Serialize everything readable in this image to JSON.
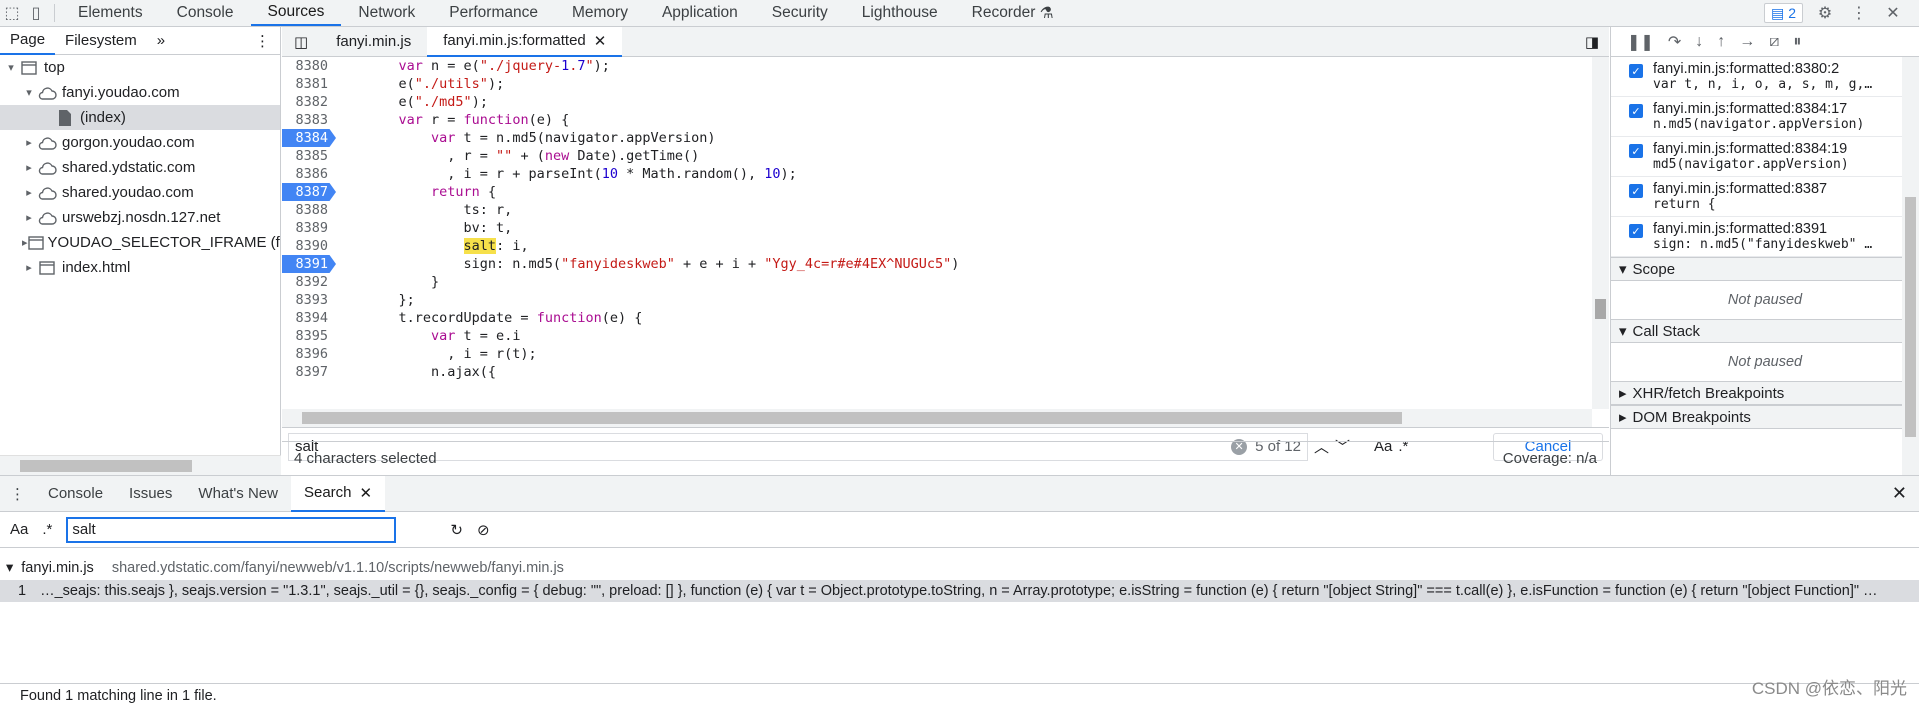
{
  "toolbar": {
    "tabs": [
      "Elements",
      "Console",
      "Sources",
      "Network",
      "Performance",
      "Memory",
      "Application",
      "Security",
      "Lighthouse",
      "Recorder"
    ],
    "issues_count": "2"
  },
  "left": {
    "tabs": [
      "Page",
      "Filesystem"
    ],
    "tree": [
      {
        "label": "top",
        "level": 0,
        "icon": "frame",
        "expanded": true
      },
      {
        "label": "fanyi.youdao.com",
        "level": 1,
        "icon": "cloud",
        "expanded": true
      },
      {
        "label": "(index)",
        "level": 2,
        "icon": "file",
        "selected": true
      },
      {
        "label": "gorgon.youdao.com",
        "level": 1,
        "icon": "cloud"
      },
      {
        "label": "shared.ydstatic.com",
        "level": 1,
        "icon": "cloud"
      },
      {
        "label": "shared.youdao.com",
        "level": 1,
        "icon": "cloud"
      },
      {
        "label": "urswebzj.nosdn.127.net",
        "level": 1,
        "icon": "cloud"
      },
      {
        "label": "YOUDAO_SELECTOR_IFRAME (fany",
        "level": 1,
        "icon": "frame"
      },
      {
        "label": "index.html",
        "level": 1,
        "icon": "frame"
      }
    ]
  },
  "editor": {
    "tabs": [
      "fanyi.min.js",
      "fanyi.min.js:formatted"
    ],
    "lines": [
      {
        "n": "8380",
        "t": "    var n = e(\"./jquery-1.7\");"
      },
      {
        "n": "8381",
        "t": "    e(\"./utils\");"
      },
      {
        "n": "8382",
        "t": "    e(\"./md5\");"
      },
      {
        "n": "8383",
        "t": "    var r = function(e) {"
      },
      {
        "n": "8384",
        "t": "        var t = n.md5(navigator.appVersion)",
        "bp": true
      },
      {
        "n": "8385",
        "t": "          , r = \"\" + (new Date).getTime()"
      },
      {
        "n": "8386",
        "t": "          , i = r + parseInt(10 * Math.random(), 10);"
      },
      {
        "n": "8387",
        "t": "        return {",
        "bp": true
      },
      {
        "n": "8388",
        "t": "            ts: r,"
      },
      {
        "n": "8389",
        "t": "            bv: t,"
      },
      {
        "n": "8390",
        "t": "            salt: i,",
        "hl": "salt"
      },
      {
        "n": "8391",
        "t": "            sign: n.md5(\"fanyideskweb\" + e + i + \"Ygy_4c=r#e#4EX^NUGUc5\")",
        "bp": true
      },
      {
        "n": "8392",
        "t": "        }"
      },
      {
        "n": "8393",
        "t": "    };"
      },
      {
        "n": "8394",
        "t": "    t.recordUpdate = function(e) {"
      },
      {
        "n": "8395",
        "t": "        var t = e.i"
      },
      {
        "n": "8396",
        "t": "          , i = r(t);"
      },
      {
        "n": "8397",
        "t": "        n.ajax({"
      }
    ],
    "find": {
      "value": "salt",
      "count": "5 of 12",
      "cancel": "Cancel"
    },
    "status_left": "4 characters selected",
    "status_right": "Coverage: n/a"
  },
  "breakpoints": [
    {
      "loc": "fanyi.min.js:formatted:8380:2",
      "code": "var t, n, i, o, a, s, m, g,…"
    },
    {
      "loc": "fanyi.min.js:formatted:8384:17",
      "code": "n.md5(navigator.appVersion)"
    },
    {
      "loc": "fanyi.min.js:formatted:8384:19",
      "code": "md5(navigator.appVersion)"
    },
    {
      "loc": "fanyi.min.js:formatted:8387",
      "code": "return {"
    },
    {
      "loc": "fanyi.min.js:formatted:8391",
      "code": "sign: n.md5(\"fanyideskweb\" …"
    }
  ],
  "sections": {
    "scope": "Scope",
    "callstack": "Call Stack",
    "notpaused": "Not paused",
    "xhr": "XHR/fetch Breakpoints",
    "dom": "DOM Breakpoints"
  },
  "drawer": {
    "tabs": [
      "Console",
      "Issues",
      "What's New",
      "Search"
    ],
    "search_value": "salt",
    "result_file": "fanyi.min.js",
    "result_path": "shared.ydstatic.com/fanyi/newweb/v1.1.10/scripts/newweb/fanyi.min.js",
    "result_line_no": "1",
    "result_text": "…_seajs: this.seajs }, seajs.version = \"1.3.1\", seajs._util = {}, seajs._config = { debug: \"\", preload: [] }, function (e) { var t = Object.prototype.toString, n = Array.prototype; e.isString = function (e) { return \"[object String]\" === t.call(e) }, e.isFunction = function (e) { return \"[object Function]\" …",
    "found": "Found 1 matching line in 1 file."
  },
  "watermark": "CSDN @依恋、阳光"
}
